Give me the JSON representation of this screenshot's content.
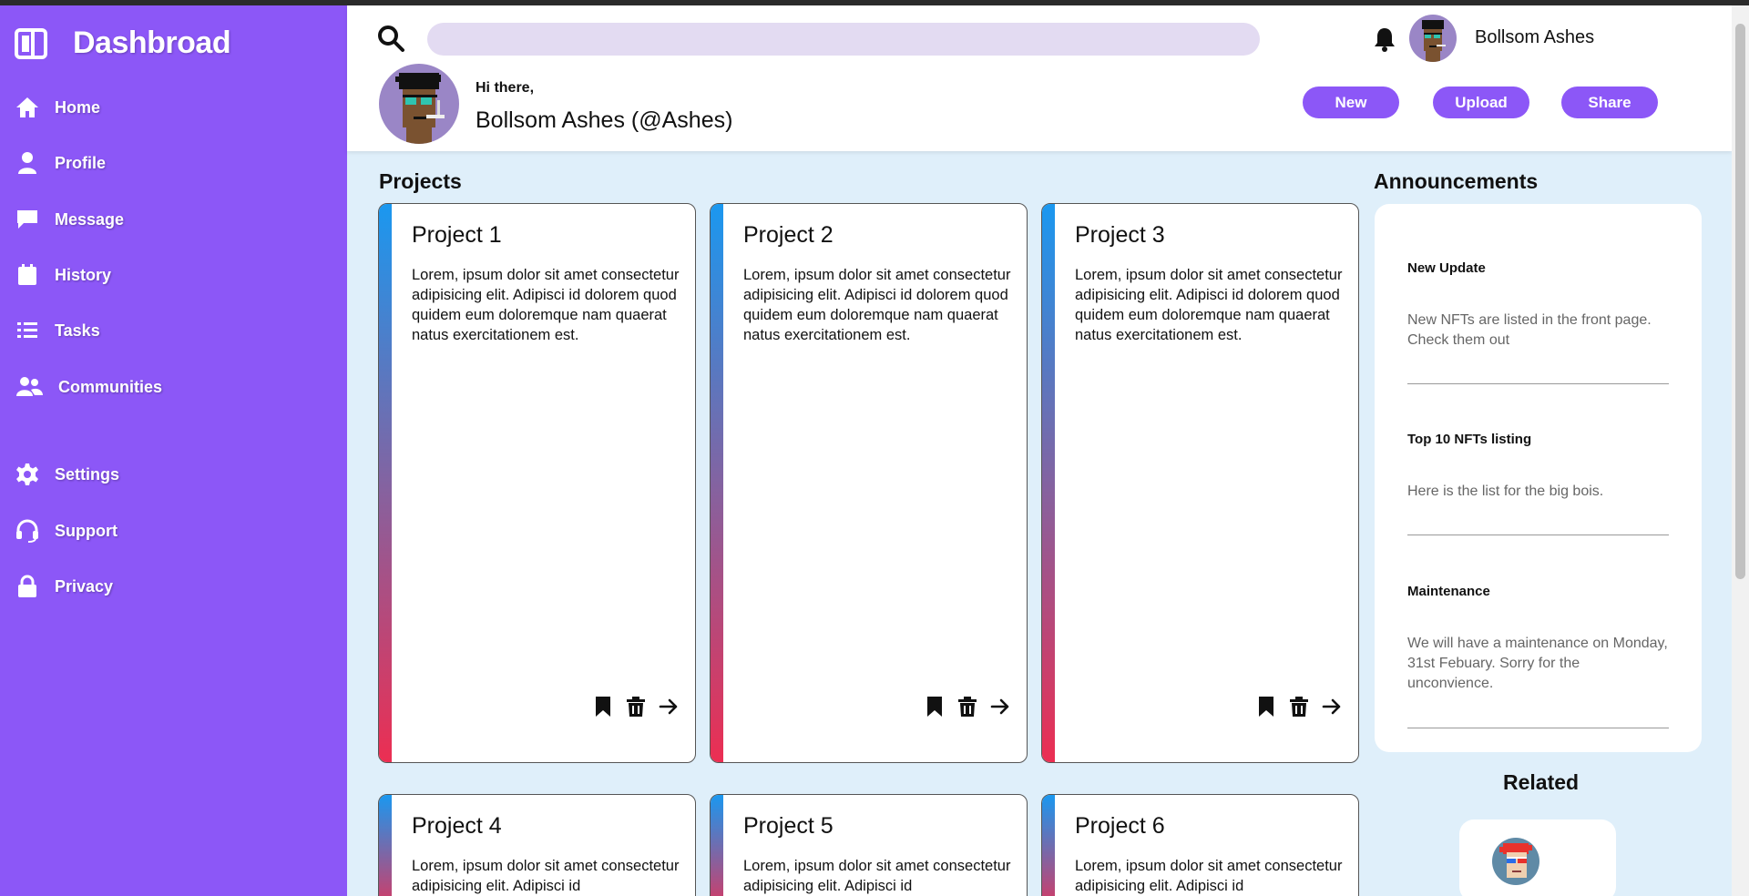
{
  "sidebar": {
    "brand": "Dashbroad",
    "items": [
      {
        "label": "Home",
        "icon": "home-icon"
      },
      {
        "label": "Profile",
        "icon": "user-icon"
      },
      {
        "label": "Message",
        "icon": "message-icon"
      },
      {
        "label": "History",
        "icon": "calendar-icon"
      },
      {
        "label": "Tasks",
        "icon": "list-icon"
      },
      {
        "label": "Communities",
        "icon": "users-icon"
      },
      {
        "label": "Settings",
        "icon": "gear-icon"
      },
      {
        "label": "Support",
        "icon": "headset-icon"
      },
      {
        "label": "Privacy",
        "icon": "lock-icon"
      }
    ]
  },
  "header": {
    "search": {
      "placeholder": "",
      "value": ""
    },
    "user_name": "Bollsom Ashes",
    "greeting": "Hi there,",
    "full_name": "Bollsom Ashes (@Ashes)",
    "buttons": {
      "new": "New",
      "upload": "Upload",
      "share": "Share"
    }
  },
  "main": {
    "projects_title": "Projects",
    "projects": [
      {
        "title": "Project 1",
        "body": "Lorem, ipsum dolor sit amet consectetur adipisicing elit. Adipisci id dolorem quod quidem eum doloremque nam quaerat natus exercitationem est."
      },
      {
        "title": "Project 2",
        "body": "Lorem, ipsum dolor sit amet consectetur adipisicing elit. Adipisci id dolorem quod quidem eum doloremque nam quaerat natus exercitationem est."
      },
      {
        "title": "Project 3",
        "body": "Lorem, ipsum dolor sit amet consectetur adipisicing elit. Adipisci id dolorem quod quidem eum doloremque nam quaerat natus exercitationem est."
      },
      {
        "title": "Project 4",
        "body": "Lorem, ipsum dolor sit amet consectetur adipisicing elit. Adipisci id"
      },
      {
        "title": "Project 5",
        "body": "Lorem, ipsum dolor sit amet consectetur adipisicing elit. Adipisci id"
      },
      {
        "title": "Project 6",
        "body": "Lorem, ipsum dolor sit amet consectetur adipisicing elit. Adipisci id"
      }
    ],
    "announcements_title": "Announcements",
    "announcements": [
      {
        "title": "New Update",
        "text": "New NFTs are listed in the front page. Check them out"
      },
      {
        "title": "Top 10 NFTs listing",
        "text": "Here is the list for the big bois."
      },
      {
        "title": "Maintenance",
        "text": "We will have a maintenance on Monday, 31st Febuary. Sorry for the unconvience."
      }
    ],
    "related_title": "Related"
  },
  "colors": {
    "sidebar": "#8c57f7",
    "accent": "#8c57f7",
    "background": "#dfeffa",
    "search_bg": "#e3dbf2",
    "gradient_top": "#1a98f0",
    "gradient_bottom": "#ec2e52"
  }
}
